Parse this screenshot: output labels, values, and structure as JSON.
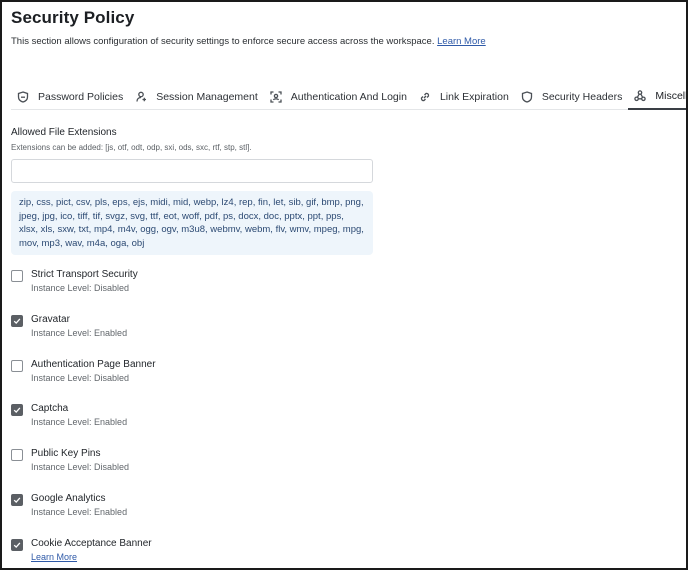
{
  "page": {
    "title": "Security Policy",
    "description": "This section allows configuration of security settings to enforce secure access across the workspace.",
    "learn_more": "Learn More"
  },
  "tabs": [
    {
      "label": "Password Policies",
      "icon": "shield-icon"
    },
    {
      "label": "Session Management",
      "icon": "user-session-icon"
    },
    {
      "label": "Authentication And Login",
      "icon": "scan-face-icon"
    },
    {
      "label": "Link Expiration",
      "icon": "link-icon"
    },
    {
      "label": "Security Headers",
      "icon": "shield-outline-icon"
    },
    {
      "label": "Miscellaneous",
      "icon": "share-nodes-icon",
      "active": true
    }
  ],
  "extensions": {
    "label": "Allowed File Extensions",
    "hint": "Extensions can be added: [js, otf, odt, odp, sxi, ods, sxc, rtf, stp, stl].",
    "input_value": "",
    "list": "zip, css, pict, csv, pls, eps, ejs, midi, mid, webp, lz4, rep, fin, let, sib, gif, bmp, png, jpeg, jpg, ico, tiff, tif, svgz, svg, ttf, eot, woff, pdf, ps, docx, doc, pptx, ppt, pps, xlsx, xls, sxw, txt, mp4, m4v, ogg, ogv, m3u8, webmv, webm, flv, wmv, mpeg, mpg, mov, mp3, wav, m4a, oga, obj"
  },
  "settings": [
    {
      "title": "Strict Transport Security",
      "sub": "Instance Level: Disabled",
      "checked": false
    },
    {
      "title": "Gravatar",
      "sub": "Instance Level: Enabled",
      "checked": true
    },
    {
      "title": "Authentication Page Banner",
      "sub": "Instance Level: Disabled",
      "checked": false
    },
    {
      "title": "Captcha",
      "sub": "Instance Level: Enabled",
      "checked": true
    },
    {
      "title": "Public Key Pins",
      "sub": "Instance Level: Disabled",
      "checked": false
    },
    {
      "title": "Google Analytics",
      "sub": "Instance Level: Enabled",
      "checked": true
    },
    {
      "title": "Cookie Acceptance Banner",
      "link": "Learn More",
      "checked": true
    }
  ],
  "colors": {
    "accent_link": "#2f5aa8",
    "checkbox_checked": "#5b5f64",
    "extension_box_bg": "#eef5fb"
  }
}
